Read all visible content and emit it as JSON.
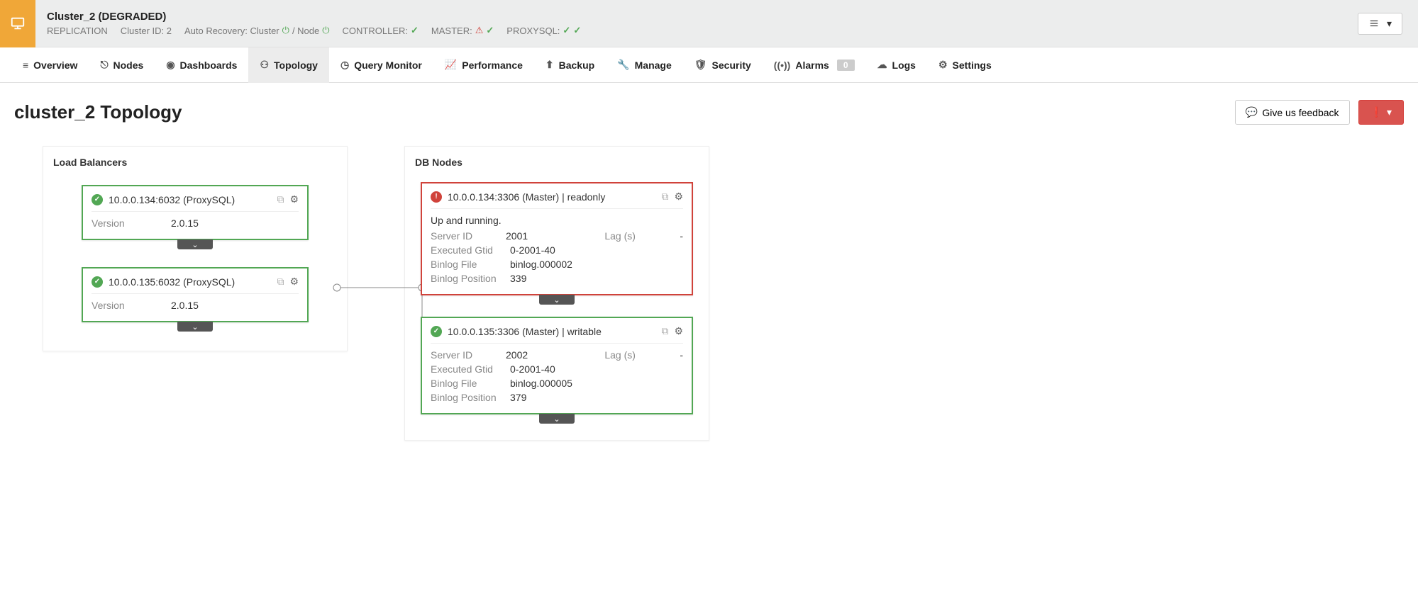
{
  "header": {
    "title": "Cluster_2 (DEGRADED)",
    "type": "REPLICATION",
    "cluster_id_label": "Cluster ID: 2",
    "auto_recovery_prefix": "Auto Recovery: Cluster",
    "auto_recovery_mid": "/ Node",
    "controller_label": "CONTROLLER:",
    "master_label": "MASTER:",
    "proxysql_label": "PROXYSQL:"
  },
  "nav": {
    "overview": "Overview",
    "nodes": "Nodes",
    "dashboards": "Dashboards",
    "topology": "Topology",
    "query_monitor": "Query Monitor",
    "performance": "Performance",
    "backup": "Backup",
    "manage": "Manage",
    "security": "Security",
    "alarms": "Alarms",
    "alarms_count": "0",
    "logs": "Logs",
    "settings": "Settings"
  },
  "page": {
    "title": "cluster_2 Topology",
    "feedback_label": "Give us feedback"
  },
  "groups": {
    "lb_title": "Load Balancers",
    "db_title": "DB Nodes"
  },
  "lb": [
    {
      "title": "10.0.0.134:6032 (ProxySQL)",
      "version_label": "Version",
      "version": "2.0.15"
    },
    {
      "title": "10.0.0.135:6032 (ProxySQL)",
      "version_label": "Version",
      "version": "2.0.15"
    }
  ],
  "db": [
    {
      "title": "10.0.0.134:3306 (Master) | readonly",
      "status_msg": "Up and running.",
      "server_id_label": "Server ID",
      "server_id": "2001",
      "lag_label": "Lag (s)",
      "lag": "-",
      "gtid_label": "Executed Gtid",
      "gtid": "0-2001-40",
      "binlog_file_label": "Binlog File",
      "binlog_file": "binlog.000002",
      "binlog_pos_label": "Binlog Position",
      "binlog_pos": "339"
    },
    {
      "title": "10.0.0.135:3306 (Master) | writable",
      "server_id_label": "Server ID",
      "server_id": "2002",
      "lag_label": "Lag (s)",
      "lag": "-",
      "gtid_label": "Executed Gtid",
      "gtid": "0-2001-40",
      "binlog_file_label": "Binlog File",
      "binlog_file": "binlog.000005",
      "binlog_pos_label": "Binlog Position",
      "binlog_pos": "379"
    }
  ]
}
